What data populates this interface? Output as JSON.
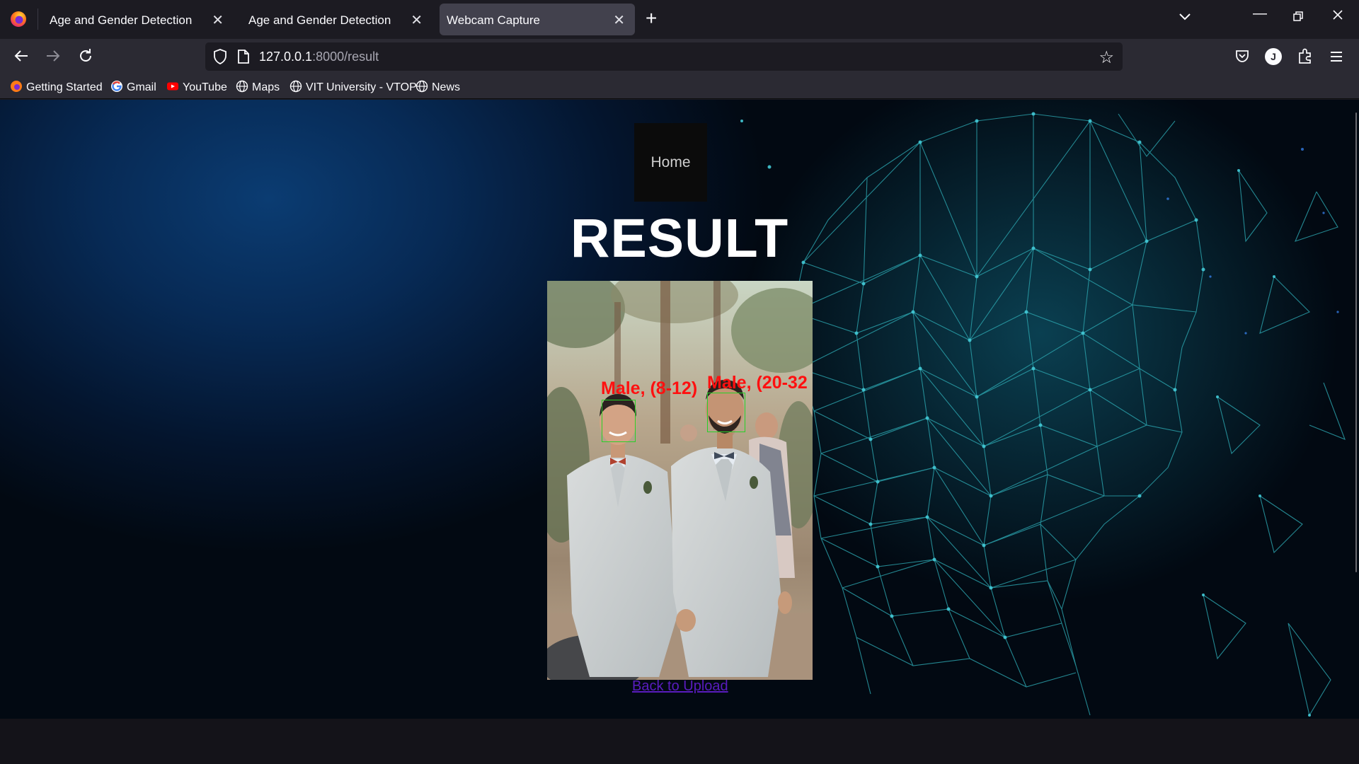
{
  "tabs": [
    {
      "title": "Age and Gender Detection",
      "active": false
    },
    {
      "title": "Age and Gender Detection",
      "active": false
    },
    {
      "title": "Webcam Capture",
      "active": true
    }
  ],
  "nav": {
    "url_host": "127.0.0.1",
    "url_rest": ":8000/result"
  },
  "bookmarks": [
    {
      "label": "Getting Started",
      "icon": "firefox-icon"
    },
    {
      "label": "Gmail",
      "icon": "google-icon"
    },
    {
      "label": "YouTube",
      "icon": "youtube-icon"
    },
    {
      "label": "Maps",
      "icon": "globe-icon"
    },
    {
      "label": "VIT University - VTOP",
      "icon": "globe-icon"
    },
    {
      "label": "News",
      "icon": "globe-icon"
    }
  ],
  "profile": {
    "initial": "J"
  },
  "page": {
    "home_label": "Home",
    "title": "RESULT",
    "back_link": "Back to Upload",
    "detections": [
      {
        "label": "Male, (8-12)"
      },
      {
        "label": "Male, (20-32"
      }
    ]
  },
  "colors": {
    "detection_label": "#ff1010",
    "face_box": "#28d028",
    "accent_network": "#2fb3b8",
    "link": "#5a1cbf"
  }
}
